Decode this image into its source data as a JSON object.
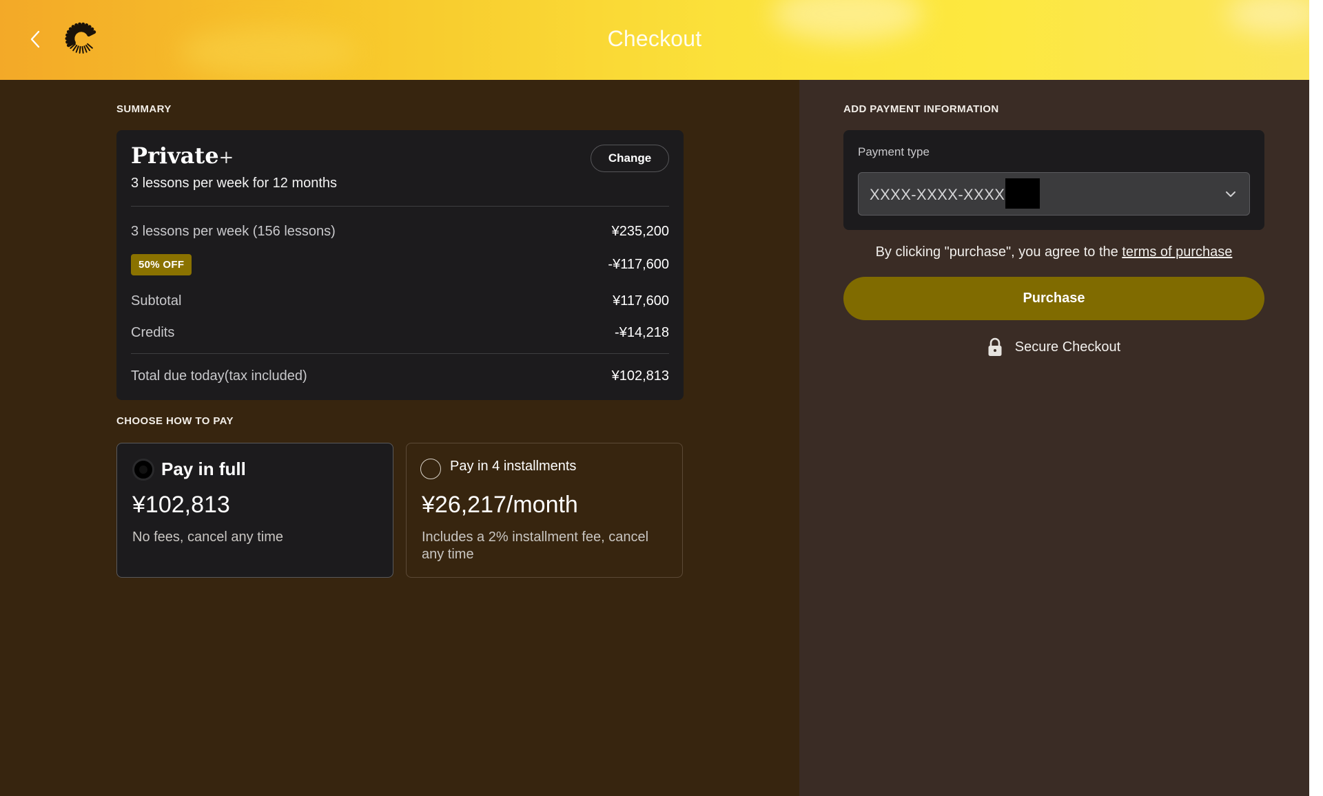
{
  "header": {
    "title": "Checkout",
    "back_icon": "chevron-left-icon",
    "logo_icon": "brand-logo-icon"
  },
  "summary": {
    "section_label": "SUMMARY",
    "plan_name": "Private",
    "plan_suffix": "+",
    "plan_description": "3 lessons per week for 12 months",
    "change_label": "Change",
    "rows": [
      {
        "label": "3 lessons per week (156 lessons)",
        "value": "¥235,200"
      },
      {
        "badge": "50% OFF",
        "value": "-¥117,600"
      },
      {
        "label": "Subtotal",
        "value": "¥117,600"
      },
      {
        "label": "Credits",
        "value": "-¥14,218"
      }
    ],
    "total": {
      "label": "Total due today(tax included)",
      "value": "¥102,813"
    }
  },
  "pay_options": {
    "section_label": "CHOOSE HOW TO PAY",
    "options": [
      {
        "title": "Pay in full",
        "amount": "¥102,813",
        "note": "No fees, cancel any time",
        "selected": true
      },
      {
        "title": "Pay in 4 installments",
        "amount": "¥26,217/month",
        "note": "Includes a 2% installment fee, cancel any time",
        "selected": false
      }
    ]
  },
  "payment": {
    "section_label": "ADD PAYMENT INFORMATION",
    "type_label": "Payment type",
    "card_value": "XXXX-XXXX-XXXX-",
    "terms_prefix": "By clicking \"purchase\", you agree to the ",
    "terms_link": "terms of purchase",
    "purchase_label": "Purchase",
    "secure_label": "Secure Checkout"
  },
  "colors": {
    "accent": "#806b00",
    "badge": "#8a7200",
    "left_bg": "#37250f",
    "right_bg": "#3a2c25",
    "card_bg": "#1c1b1d"
  }
}
